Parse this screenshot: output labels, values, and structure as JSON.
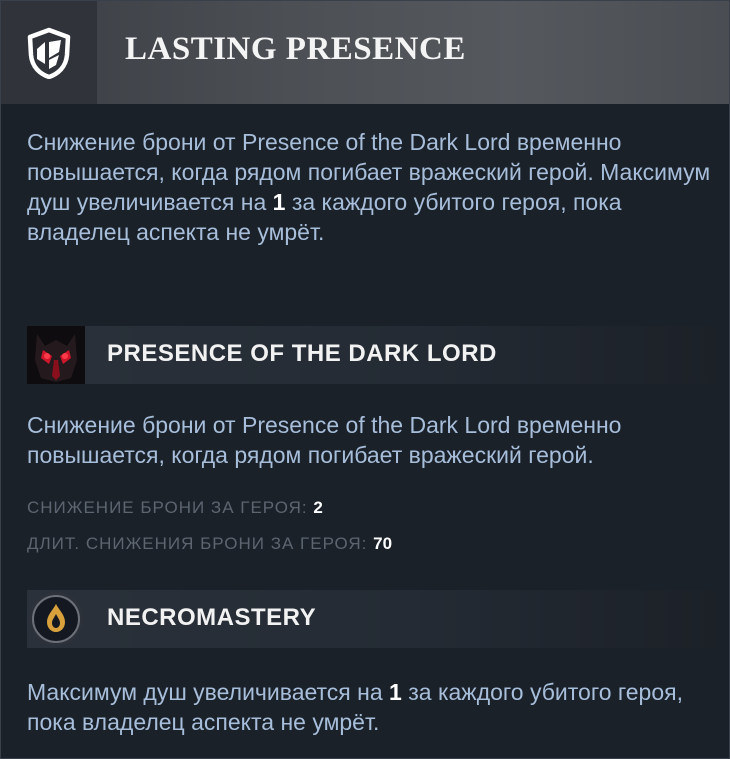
{
  "header": {
    "title": "LASTING PRESENCE",
    "icon": "shield-aspect-icon"
  },
  "aspect": {
    "description_part1": "Снижение брони от Presence of the Dark Lord временно повышается, когда рядом погибает вражеский герой. Максимум душ увеличивается на ",
    "description_value": "1",
    "description_part2": " за каждого убитого героя, пока владелец аспекта не умрёт."
  },
  "abilities": [
    {
      "title": "PRESENCE OF THE DARK LORD",
      "icon": "dark-lord-portrait-icon",
      "description": "Снижение брони от Presence of the Dark Lord временно повышается, когда рядом погибает вражеский герой.",
      "stats": [
        {
          "label": "СНИЖЕНИЕ БРОНИ ЗА ГЕРОЯ: ",
          "value": "2"
        },
        {
          "label": "ДЛИТ. СНИЖЕНИЯ БРОНИ ЗА ГЕРОЯ: ",
          "value": "70"
        }
      ]
    },
    {
      "title": "NECROMASTERY",
      "icon": "soul-flame-icon",
      "description_part1": "Максимум душ увеличивается на ",
      "description_value": "1",
      "description_part2": " за каждого убитого героя, пока владелец аспекта не умрёт."
    }
  ]
}
